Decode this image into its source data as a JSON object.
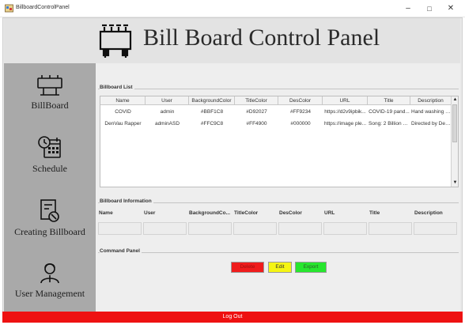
{
  "window": {
    "title": "BillboardControlPanel",
    "minimize_glyph": "–",
    "maximize_glyph": "□",
    "close_glyph": "✕"
  },
  "header": {
    "title": "Bill Board Control Panel",
    "icon": "billboard-logo-icon"
  },
  "sidebar": {
    "items": [
      {
        "label": "BillBoard",
        "icon": "billboard-icon"
      },
      {
        "label": "Schedule",
        "icon": "calendar-clock-icon"
      },
      {
        "label": "Creating Billboard",
        "icon": "create-document-icon"
      },
      {
        "label": "User Management",
        "icon": "users-icon"
      }
    ]
  },
  "billboard_list": {
    "title": "Billboard List",
    "columns": [
      "Name",
      "User",
      "BackgroundColor",
      "TitleColor",
      "DesColor",
      "URL",
      "Title",
      "Description"
    ],
    "rows": [
      [
        "COVID",
        "admin",
        "#BBF1C8",
        "#D92027",
        "#FF9234",
        "https://d2v9ipbik...",
        "COVID-19 pand...",
        "Hand washing is..."
      ],
      [
        "DenVau Rapper",
        "adminASD",
        "#FFC9C8",
        "#FF4900",
        "#000000",
        "https://image ple...",
        "Song: 2 Billion Y...",
        "Directed by Den..."
      ]
    ],
    "scroll_up_glyph": "▲",
    "scroll_down_glyph": "▼"
  },
  "billboard_information": {
    "title": "Billboard Information",
    "labels": [
      "Name",
      "User",
      "BackgroundCo...",
      "TitleColor",
      "DesColor",
      "URL",
      "Title",
      "Description"
    ],
    "values": [
      "",
      "",
      "",
      "",
      "",
      "",
      "",
      ""
    ]
  },
  "command_panel": {
    "title": "Command Panel",
    "delete_label": "Delete",
    "edit_label": "Edit",
    "export_label": "Export"
  },
  "footer": {
    "logout_label": "Log Out"
  },
  "colors": {
    "sidebar_bg": "#a9a9a9",
    "header_bg": "#e3e3e3",
    "logout_bg": "#ee1111",
    "delete_bg": "#ef1c1c",
    "edit_bg": "#f5f514",
    "export_bg": "#27e62e"
  }
}
